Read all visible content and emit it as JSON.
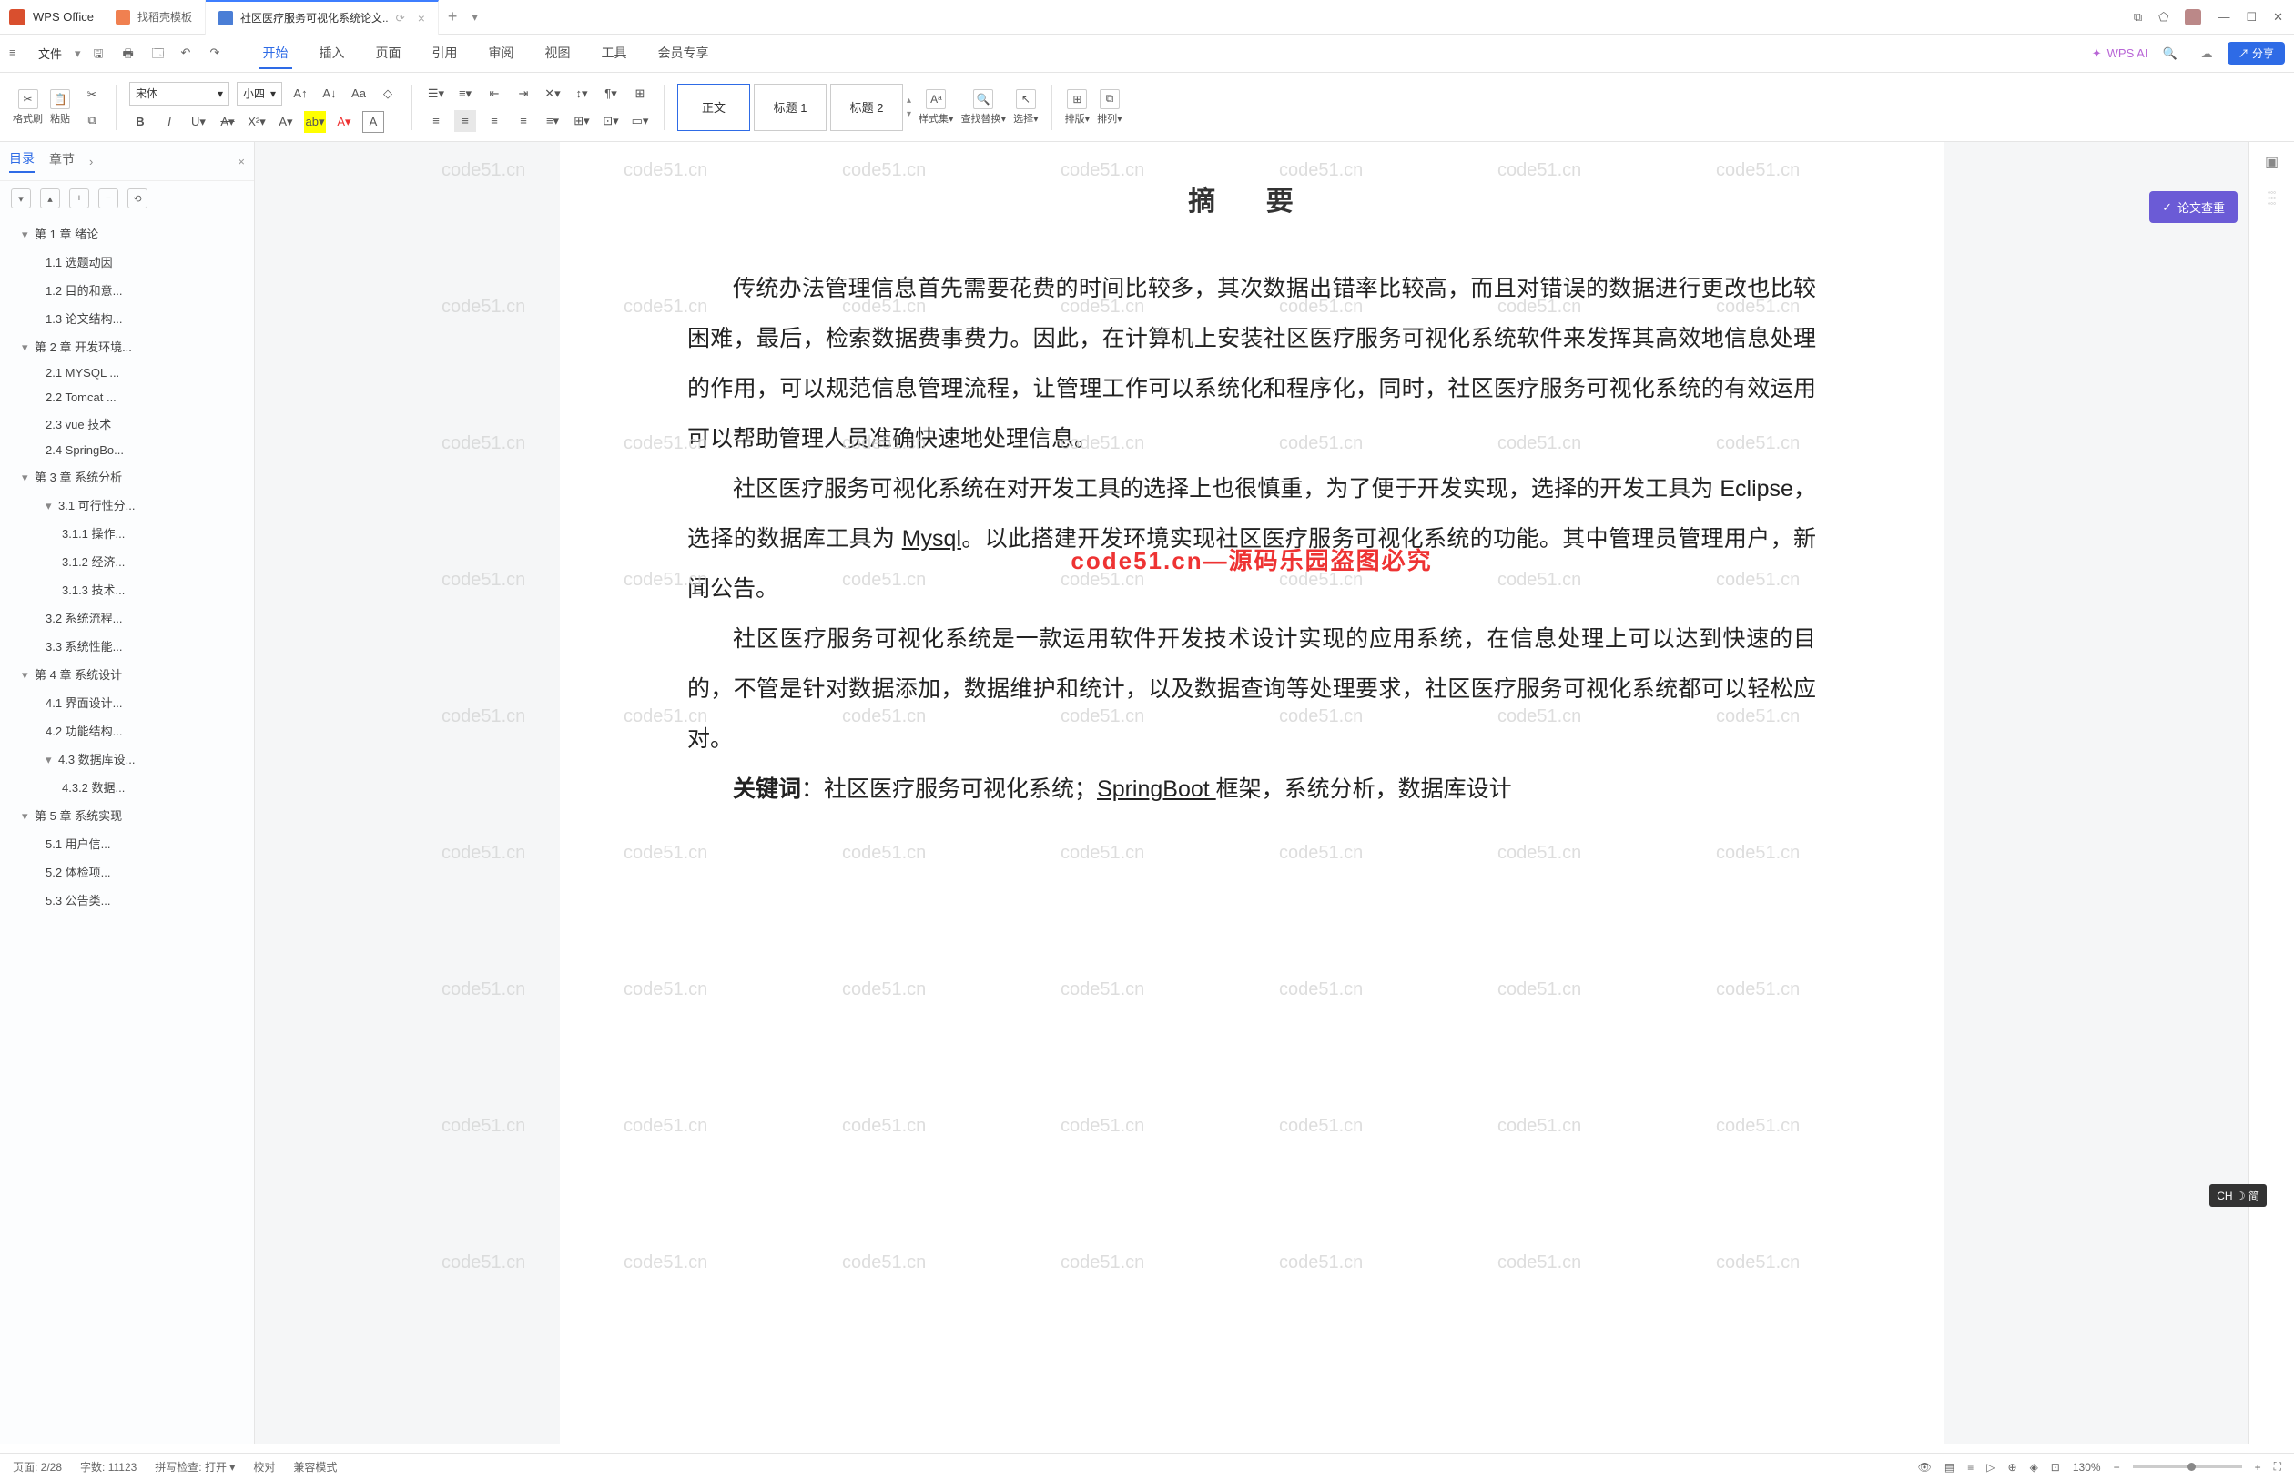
{
  "titlebar": {
    "app": "WPS Office",
    "tabs": [
      {
        "label": "找稻壳模板"
      },
      {
        "label": "社区医疗服务可视化系统论文..",
        "active": true
      }
    ],
    "plus": "+"
  },
  "menubar": {
    "file": "文件",
    "items": [
      "开始",
      "插入",
      "页面",
      "引用",
      "审阅",
      "视图",
      "工具",
      "会员专享"
    ],
    "active": "开始",
    "ai": "WPS AI",
    "share": "分享"
  },
  "ribbon": {
    "format_painter": "格式刷",
    "paste": "粘贴",
    "font": "宋体",
    "size": "小四",
    "styles": {
      "normal": "正文",
      "h1": "标题 1",
      "h2": "标题 2"
    },
    "style_set": "样式集",
    "find": "查找替换",
    "select": "选择",
    "arrange": "排版",
    "sort": "排列"
  },
  "sidebar": {
    "tabs": {
      "toc": "目录",
      "chapters": "章节"
    },
    "toc": [
      {
        "l": 1,
        "t": "第 1 章 绪论",
        "c": true
      },
      {
        "l": 2,
        "t": "1.1 选题动因"
      },
      {
        "l": 2,
        "t": "1.2 目的和意..."
      },
      {
        "l": 2,
        "t": "1.3 论文结构..."
      },
      {
        "l": 1,
        "t": "第 2 章 开发环境...",
        "c": true
      },
      {
        "l": 2,
        "t": "2.1 MYSQL ..."
      },
      {
        "l": 2,
        "t": "2.2 Tomcat ..."
      },
      {
        "l": 2,
        "t": "2.3 vue 技术"
      },
      {
        "l": 2,
        "t": "2.4 SpringBo..."
      },
      {
        "l": 1,
        "t": "第 3 章 系统分析",
        "c": true
      },
      {
        "l": 2,
        "t": "3.1 可行性分...",
        "c": true
      },
      {
        "l": 3,
        "t": "3.1.1 操作..."
      },
      {
        "l": 3,
        "t": "3.1.2 经济..."
      },
      {
        "l": 3,
        "t": "3.1.3 技术..."
      },
      {
        "l": 2,
        "t": "3.2 系统流程..."
      },
      {
        "l": 2,
        "t": "3.3 系统性能..."
      },
      {
        "l": 1,
        "t": "第 4 章 系统设计",
        "c": true
      },
      {
        "l": 2,
        "t": "4.1 界面设计..."
      },
      {
        "l": 2,
        "t": "4.2 功能结构..."
      },
      {
        "l": 2,
        "t": "4.3 数据库设...",
        "c": true
      },
      {
        "l": 3,
        "t": "4.3.2 数据..."
      },
      {
        "l": 1,
        "t": "第 5 章 系统实现",
        "c": true
      },
      {
        "l": 2,
        "t": "5.1 用户信..."
      },
      {
        "l": 2,
        "t": "5.2 体检项..."
      },
      {
        "l": 2,
        "t": "5.3 公告类..."
      }
    ]
  },
  "document": {
    "title": "摘 要",
    "p1": "传统办法管理信息首先需要花费的时间比较多，其次数据出错率比较高，而且对错误的数据进行更改也比较困难，最后，检索数据费事费力。因此，在计算机上安装社区医疗服务可视化系统软件来发挥其高效地信息处理的作用，可以规范信息管理流程，让管理工作可以系统化和程序化，同时，社区医疗服务可视化系统的有效运用可以帮助管理人员准确快速地处理信息。",
    "p2a": "社区医疗服务可视化系统在对开发工具的选择上也很慎重，为了便于开发实现，选择的开发工具为 Eclipse，选择的数据库工具为 ",
    "p2b": "Mysql",
    "p2c": "。以此搭建开发环境实现社区医疗服务可视化系统的功能。其中管理员管理用户，新闻公告。",
    "p3": "社区医疗服务可视化系统是一款运用软件开发技术设计实现的应用系统，在信息处理上可以达到快速的目的，不管是针对数据添加，数据维护和统计，以及数据查询等处理要求，社区医疗服务可视化系统都可以轻松应对。",
    "kw_label": "关键词",
    "kw_a": "：社区医疗服务可视化系统；",
    "kw_b": "SpringBoot ",
    "kw_c": "框架，系统分析，数据库设计",
    "wm_red": "code51.cn—源码乐园盗图必究",
    "wm": "code51.cn"
  },
  "floatbtn": "论文查重",
  "statusbar": {
    "page": "页面: 2/28",
    "words": "字数: 11123",
    "spell": "拼写检查: 打开",
    "proof": "校对",
    "compat": "兼容模式",
    "zoom": "130%"
  },
  "ime": "CH ☽ 简"
}
